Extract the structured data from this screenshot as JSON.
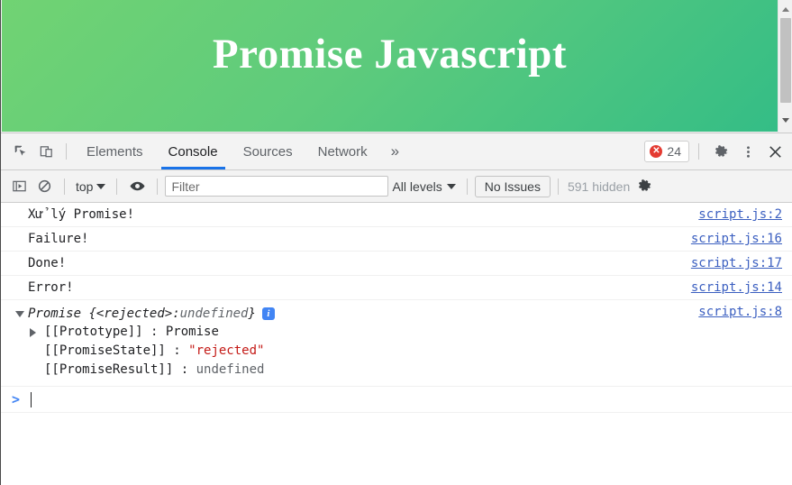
{
  "page": {
    "hero_title": "Promise Javascript",
    "scrollbar": {
      "up_icon": "scroll-up-arrow-icon",
      "down_icon": "scroll-down-arrow-icon"
    },
    "colors": {
      "gradient_start": "#71d373",
      "gradient_end": "#34bd86",
      "title": "#ffffff"
    }
  },
  "devtools": {
    "tabbar": {
      "inspect_icon": "inspect-element-icon",
      "device_icon": "toggle-device-toolbar-icon",
      "tabs": [
        {
          "label": "Elements",
          "active": false
        },
        {
          "label": "Console",
          "active": true
        },
        {
          "label": "Sources",
          "active": false
        },
        {
          "label": "Network",
          "active": false
        }
      ],
      "more_tabs_label": "»",
      "error_count": "24",
      "error_icon": "✕",
      "settings_icon": "gear-icon",
      "menu_icon": "kebab-menu-icon",
      "close_icon": "close-icon",
      "active_underline_color": "#1a73e8",
      "error_color": "#e43b32"
    },
    "filterbar": {
      "sidebar_icon": "console-sidebar-icon",
      "clear_icon": "clear-console-icon",
      "context_label": "top",
      "eye_icon": "live-expression-eye-icon",
      "filter_placeholder": "Filter",
      "filter_value": "",
      "levels_label": "All levels",
      "issues_label": "No Issues",
      "hidden_label": "591 hidden",
      "settings_icon": "console-settings-gear-icon"
    },
    "console": {
      "messages": [
        {
          "text": "Xử lý Promise!",
          "source": "script.js:2"
        },
        {
          "text": "Failure!",
          "source": "script.js:16"
        },
        {
          "text": "Done!",
          "source": "script.js:17"
        },
        {
          "text": "Error!",
          "source": "script.js:14"
        }
      ],
      "object_log": {
        "source": "script.js:8",
        "head_name": "Promise",
        "head_brace_open": "{",
        "head_state": "<rejected>",
        "head_colon": ": ",
        "head_value": "undefined",
        "head_brace_close": "}",
        "info_badge": "i",
        "props": [
          {
            "key": "[[Prototype]]",
            "sep": ": ",
            "value": "Promise",
            "value_type": "plain",
            "expandable": true
          },
          {
            "key": "[[PromiseState]]",
            "sep": ": ",
            "value": "\"rejected\"",
            "value_type": "string",
            "expandable": false
          },
          {
            "key": "[[PromiseResult]]",
            "sep": ": ",
            "value": "undefined",
            "value_type": "undefined",
            "expandable": false
          }
        ]
      },
      "prompt_symbol": ">",
      "prompt_value": "",
      "source_link_color": "#3b5fc0",
      "string_color": "#c41a16"
    }
  }
}
